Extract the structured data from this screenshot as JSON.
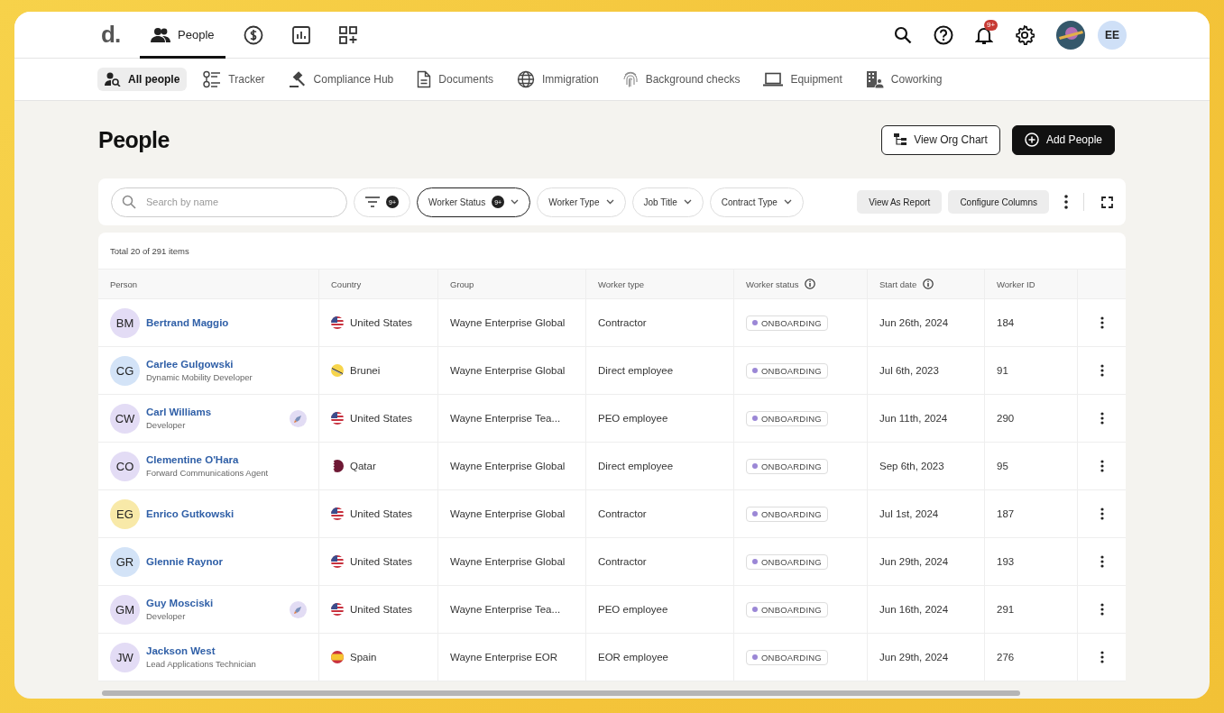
{
  "app_bar": {
    "logo": "d.",
    "tabs": [
      {
        "kind": "people",
        "label": "People",
        "selected": true
      },
      {
        "kind": "dollar",
        "selected": false
      },
      {
        "kind": "chart",
        "selected": false
      },
      {
        "kind": "apps",
        "selected": false
      }
    ],
    "notifications": {
      "count": "9+"
    },
    "profile": {
      "initials": "EE"
    }
  },
  "sub_nav": [
    {
      "kind": "person-search",
      "label": "All people",
      "selected": true
    },
    {
      "kind": "tracker",
      "label": "Tracker",
      "selected": false
    },
    {
      "kind": "gavel",
      "label": "Compliance Hub",
      "selected": false
    },
    {
      "kind": "document",
      "label": "Documents",
      "selected": false
    },
    {
      "kind": "globe",
      "label": "Immigration",
      "selected": false
    },
    {
      "kind": "fingerprint",
      "label": "Background checks",
      "selected": false
    },
    {
      "kind": "laptop",
      "label": "Equipment",
      "selected": false
    },
    {
      "kind": "building",
      "label": "Coworking",
      "selected": false
    }
  ],
  "page": {
    "title": "People",
    "actions": [
      {
        "kind": "secondary",
        "label": "View Org Chart"
      },
      {
        "kind": "primary",
        "label": "Add People"
      }
    ]
  },
  "toolbar": {
    "search": {
      "placeholder": "Search by name"
    },
    "filter_count": "9+",
    "filters": [
      {
        "label": "Worker Status",
        "count": "9+",
        "selected": true
      },
      {
        "label": "Worker Type",
        "selected": false
      },
      {
        "label": "Job Title",
        "selected": false
      },
      {
        "label": "Contract Type",
        "selected": false
      }
    ],
    "buttons": [
      "View As Report",
      "Configure Columns"
    ]
  },
  "table": {
    "total": "Total 20 of 291 items",
    "columns": [
      {
        "label": "Person",
        "info": false
      },
      {
        "label": "Country",
        "info": false
      },
      {
        "label": "Group",
        "info": false
      },
      {
        "label": "Worker type",
        "info": false
      },
      {
        "label": "Worker status",
        "info": true
      },
      {
        "label": "Start date",
        "info": true
      },
      {
        "label": "Worker ID",
        "info": false
      }
    ],
    "rows": [
      {
        "initials": "BM",
        "color": "#e3dcf5",
        "name": "Bertrand Maggio",
        "rocket": false,
        "country": {
          "name": "United States",
          "kind": "us"
        },
        "group": "Wayne Enterprise Global",
        "worker_type": "Contractor",
        "status": "ONBOARDING",
        "start_date": "Jun 26th, 2024",
        "worker_id": "184"
      },
      {
        "initials": "CG",
        "color": "#d3e3f7",
        "name": "Carlee Gulgowski",
        "title": "Dynamic Mobility Developer",
        "rocket": false,
        "country": {
          "name": "Brunei",
          "kind": "bn"
        },
        "group": "Wayne Enterprise Global",
        "worker_type": "Direct employee",
        "status": "ONBOARDING",
        "start_date": "Jul 6th, 2023",
        "worker_id": "91"
      },
      {
        "initials": "CW",
        "color": "#e3dcf5",
        "name": "Carl Williams",
        "title": "Developer",
        "rocket": true,
        "country": {
          "name": "United States",
          "kind": "us"
        },
        "group": "Wayne Enterprise Tea...",
        "worker_type": "PEO employee",
        "status": "ONBOARDING",
        "start_date": "Jun 11th, 2024",
        "worker_id": "290"
      },
      {
        "initials": "CO",
        "color": "#e3dcf5",
        "name": "Clementine O'Hara",
        "title": "Forward Communications Agent",
        "rocket": false,
        "country": {
          "name": "Qatar",
          "kind": "qa"
        },
        "group": "Wayne Enterprise Global",
        "worker_type": "Direct employee",
        "status": "ONBOARDING",
        "start_date": "Sep 6th, 2023",
        "worker_id": "95"
      },
      {
        "initials": "EG",
        "color": "#f8e9a8",
        "name": "Enrico Gutkowski",
        "rocket": false,
        "country": {
          "name": "United States",
          "kind": "us"
        },
        "group": "Wayne Enterprise Global",
        "worker_type": "Contractor",
        "status": "ONBOARDING",
        "start_date": "Jul 1st, 2024",
        "worker_id": "187"
      },
      {
        "initials": "GR",
        "color": "#d3e3f7",
        "name": "Glennie Raynor",
        "rocket": false,
        "country": {
          "name": "United States",
          "kind": "us"
        },
        "group": "Wayne Enterprise Global",
        "worker_type": "Contractor",
        "status": "ONBOARDING",
        "start_date": "Jun 29th, 2024",
        "worker_id": "193"
      },
      {
        "initials": "GM",
        "color": "#e3dcf5",
        "name": "Guy Mosciski",
        "title": "Developer",
        "rocket": true,
        "country": {
          "name": "United States",
          "kind": "us"
        },
        "group": "Wayne Enterprise Tea...",
        "worker_type": "PEO employee",
        "status": "ONBOARDING",
        "start_date": "Jun 16th, 2024",
        "worker_id": "291"
      },
      {
        "initials": "JW",
        "color": "#e3dcf5",
        "name": "Jackson West",
        "title": "Lead Applications Technician",
        "rocket": false,
        "country": {
          "name": "Spain",
          "kind": "es"
        },
        "group": "Wayne Enterprise EOR",
        "worker_type": "EOR employee",
        "status": "ONBOARDING",
        "start_date": "Jun 29th, 2024",
        "worker_id": "276"
      }
    ]
  }
}
